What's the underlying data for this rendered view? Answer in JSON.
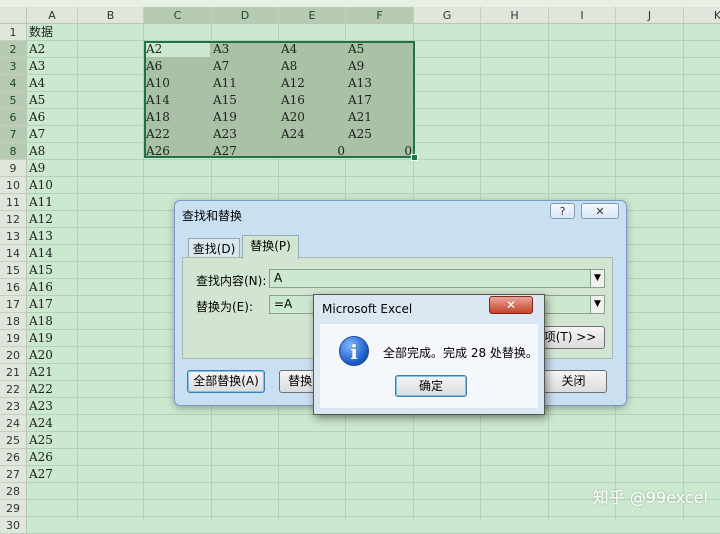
{
  "columns": [
    "A",
    "B",
    "C",
    "D",
    "E",
    "F",
    "G",
    "H",
    "I",
    "J",
    "K"
  ],
  "rows": [
    "1",
    "2",
    "3",
    "4",
    "5",
    "6",
    "7",
    "8",
    "9",
    "10",
    "11",
    "12",
    "13",
    "14",
    "15",
    "16",
    "17",
    "18",
    "19",
    "20",
    "21",
    "22",
    "23",
    "24",
    "25",
    "26",
    "27",
    "28",
    "29",
    "30"
  ],
  "column_a": [
    "数据",
    "A2",
    "A3",
    "A4",
    "A5",
    "A6",
    "A7",
    "A8",
    "A9",
    "A10",
    "A11",
    "A12",
    "A13",
    "A14",
    "A15",
    "A16",
    "A17",
    "A18",
    "A19",
    "A20",
    "A21",
    "A22",
    "A23",
    "A24",
    "A25",
    "A26",
    "A27"
  ],
  "range_cells": [
    [
      "A2",
      "A3",
      "A4",
      "A5"
    ],
    [
      "A6",
      "A7",
      "A8",
      "A9"
    ],
    [
      "A10",
      "A11",
      "A12",
      "A13"
    ],
    [
      "A14",
      "A15",
      "A16",
      "A17"
    ],
    [
      "A18",
      "A19",
      "A20",
      "A21"
    ],
    [
      "A22",
      "A23",
      "A24",
      "A25"
    ],
    [
      "A26",
      "A27",
      "0",
      "0"
    ]
  ],
  "find_replace": {
    "title": "查找和替换",
    "help_label": "?",
    "close_label": "✕",
    "tabs": [
      "查找(D)",
      "替换(P)"
    ],
    "find_label": "查找内容(N):",
    "find_value": "A",
    "replace_label": "替换为(E):",
    "replace_value": "=A",
    "options_label": "选项(T) >>",
    "replace_all_label": "全部替换(A)",
    "replace_label_btn": "替换(R)",
    "close_btn_label": "关闭"
  },
  "message_box": {
    "title": "Microsoft Excel",
    "close_label": "✕",
    "icon_glyph": "i",
    "text": "全部完成。完成 28 处替换。",
    "ok_label": "确定"
  },
  "watermark": "知乎 @99excel",
  "colors": {
    "sheet_bg": "#cce8cf",
    "selection_border": "#217346",
    "dialog_frame": "#c9dff2"
  }
}
